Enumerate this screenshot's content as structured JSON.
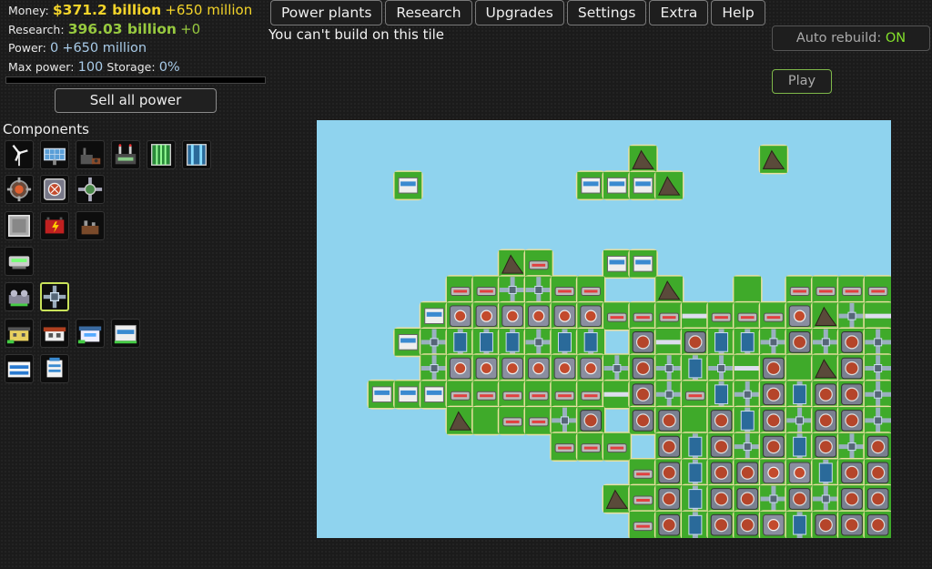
{
  "stats": {
    "money_label": "Money:",
    "money_value": "$371.2 billion",
    "money_income": "+650 million",
    "research_label": "Research:",
    "research_value": "396.03 billion",
    "research_income": "+0",
    "power_label": "Power:",
    "power_value": "0",
    "power_income": "+650 million",
    "max_power_label": "Max power:",
    "max_power_value": "100",
    "storage_label": "Storage:",
    "storage_value": "0%",
    "storage_fraction": 0
  },
  "buttons": {
    "sell_all_power": "Sell all power",
    "play": "Play"
  },
  "menu": [
    "Power plants",
    "Research",
    "Upgrades",
    "Settings",
    "Extra",
    "Help"
  ],
  "status_message": "You can't build on this tile",
  "auto_rebuild": {
    "label": "Auto rebuild:",
    "state": "ON"
  },
  "components": {
    "title": "Components",
    "rows": [
      [
        "wind-turbine-icon",
        "solar-panel-icon",
        "coal-plant-icon",
        "gas-plant-icon",
        "fuel-cell-icon",
        "fuel-cell-blue-icon"
      ],
      [
        "heat-exchanger-icon",
        "heat-inlet-icon",
        "heat-outlet-icon"
      ],
      [
        "battery-icon",
        "power-storage-icon",
        "generator-icon"
      ],
      [
        "water-pump-icon"
      ],
      [
        "ground-pump-icon",
        "pipe-junction-icon"
      ],
      [
        "small-office-icon",
        "shop-icon",
        "house-icon",
        "large-office-icon"
      ],
      [
        "bank-icon",
        "research-center-icon"
      ]
    ],
    "selected": "pipe-junction-icon"
  },
  "colors": {
    "money": "#f3d42a",
    "research": "#97c93f",
    "power": "#a8cbe8",
    "auto_on": "#84e22b",
    "water": "#8fd3ee",
    "grass": "#3faa2a"
  },
  "board": {
    "cols": 22,
    "rows": 16,
    "legend": {
      "~": "water",
      ".": "grass",
      "m": "mountain",
      "b": "office",
      "g": "generator",
      "e": "heat-exchanger",
      "c": "coal-plant",
      "p": "pump",
      "|": "pipe-vertical",
      "-": "pipe-horizontal",
      "+": "pipe-junction"
    },
    "map": [
      "~~~~~~~~~~~~~~~~~~~~~~",
      "~~~~~~~~~~~~m~~~~m~~~~",
      "~~~b~~~~~~bbbm~~~~~~~~",
      "~~~~~~~~~~~~~~~~~~~~~~",
      "~~~~~~~~~~~~~~~~~~~~~~",
      "~~~~~~~mp~~bb~~~~~~~~~",
      "~~~~~pp++pp~~m~~.~pppp",
      "~~~~bggggggppp-pppgm+-",
      "~~~b+|||+||~e-e||+e+e+",
      "~~~~+gggggg+e+|+-e.me+",
      "~~bbbpppppp-e+p|+e|ee+",
      "~~~~~m.pp+e~ee.e|e+ee+",
      "~~~~~~~~~ppp~e|e+e|e+e",
      "~~~~~~~~~~~~pe|eegg|ee",
      "~~~~~~~~~~~mpe|ee+e+ee",
      "~~~~~~~~~~~~pe|eeg|eee"
    ]
  }
}
